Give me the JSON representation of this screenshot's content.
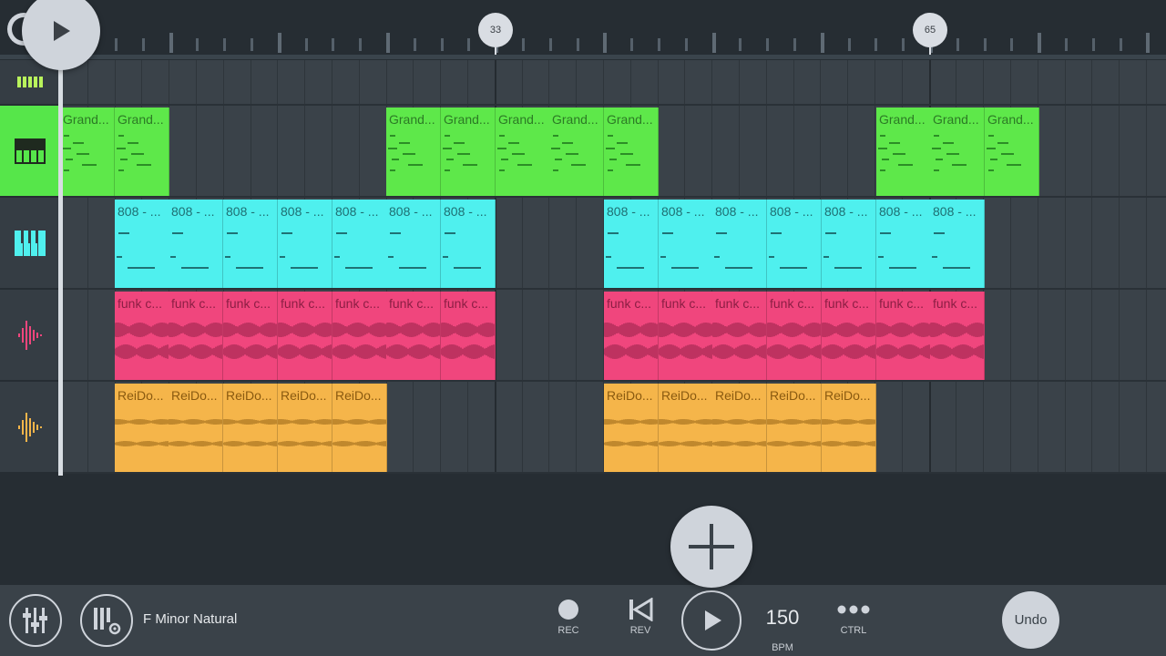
{
  "ruler": {
    "markers": [
      "33",
      "65"
    ]
  },
  "tracks": [
    {
      "name": "pattern-track",
      "icon": "pattern-grid-icon",
      "color": "#b9f35c"
    },
    {
      "name": "grand-piano-track",
      "icon": "piano-keys-icon",
      "color": "#5ee84a",
      "selected": true
    },
    {
      "name": "808-track",
      "icon": "piano-keys-icon",
      "color": "#4ff0ee"
    },
    {
      "name": "funk-track",
      "icon": "audio-wave-icon",
      "color": "#f0467d"
    },
    {
      "name": "reido-track",
      "icon": "audio-wave-icon",
      "color": "#f5b54a"
    }
  ],
  "clips": {
    "grand": "Grand...",
    "eight": "808 - ...",
    "funk": "funk c...",
    "reido": "ReiDo..."
  },
  "toolbar": {
    "mixer_icon": "mixer-sliders-icon",
    "piano_settings_icon": "piano-settings-icon",
    "scale": "F Minor Natural",
    "rec_label": "REC",
    "rev_label": "REV",
    "bpm_value": "150",
    "bpm_label": "BPM",
    "ctrl_label": "CTRL",
    "undo_label": "Undo"
  }
}
